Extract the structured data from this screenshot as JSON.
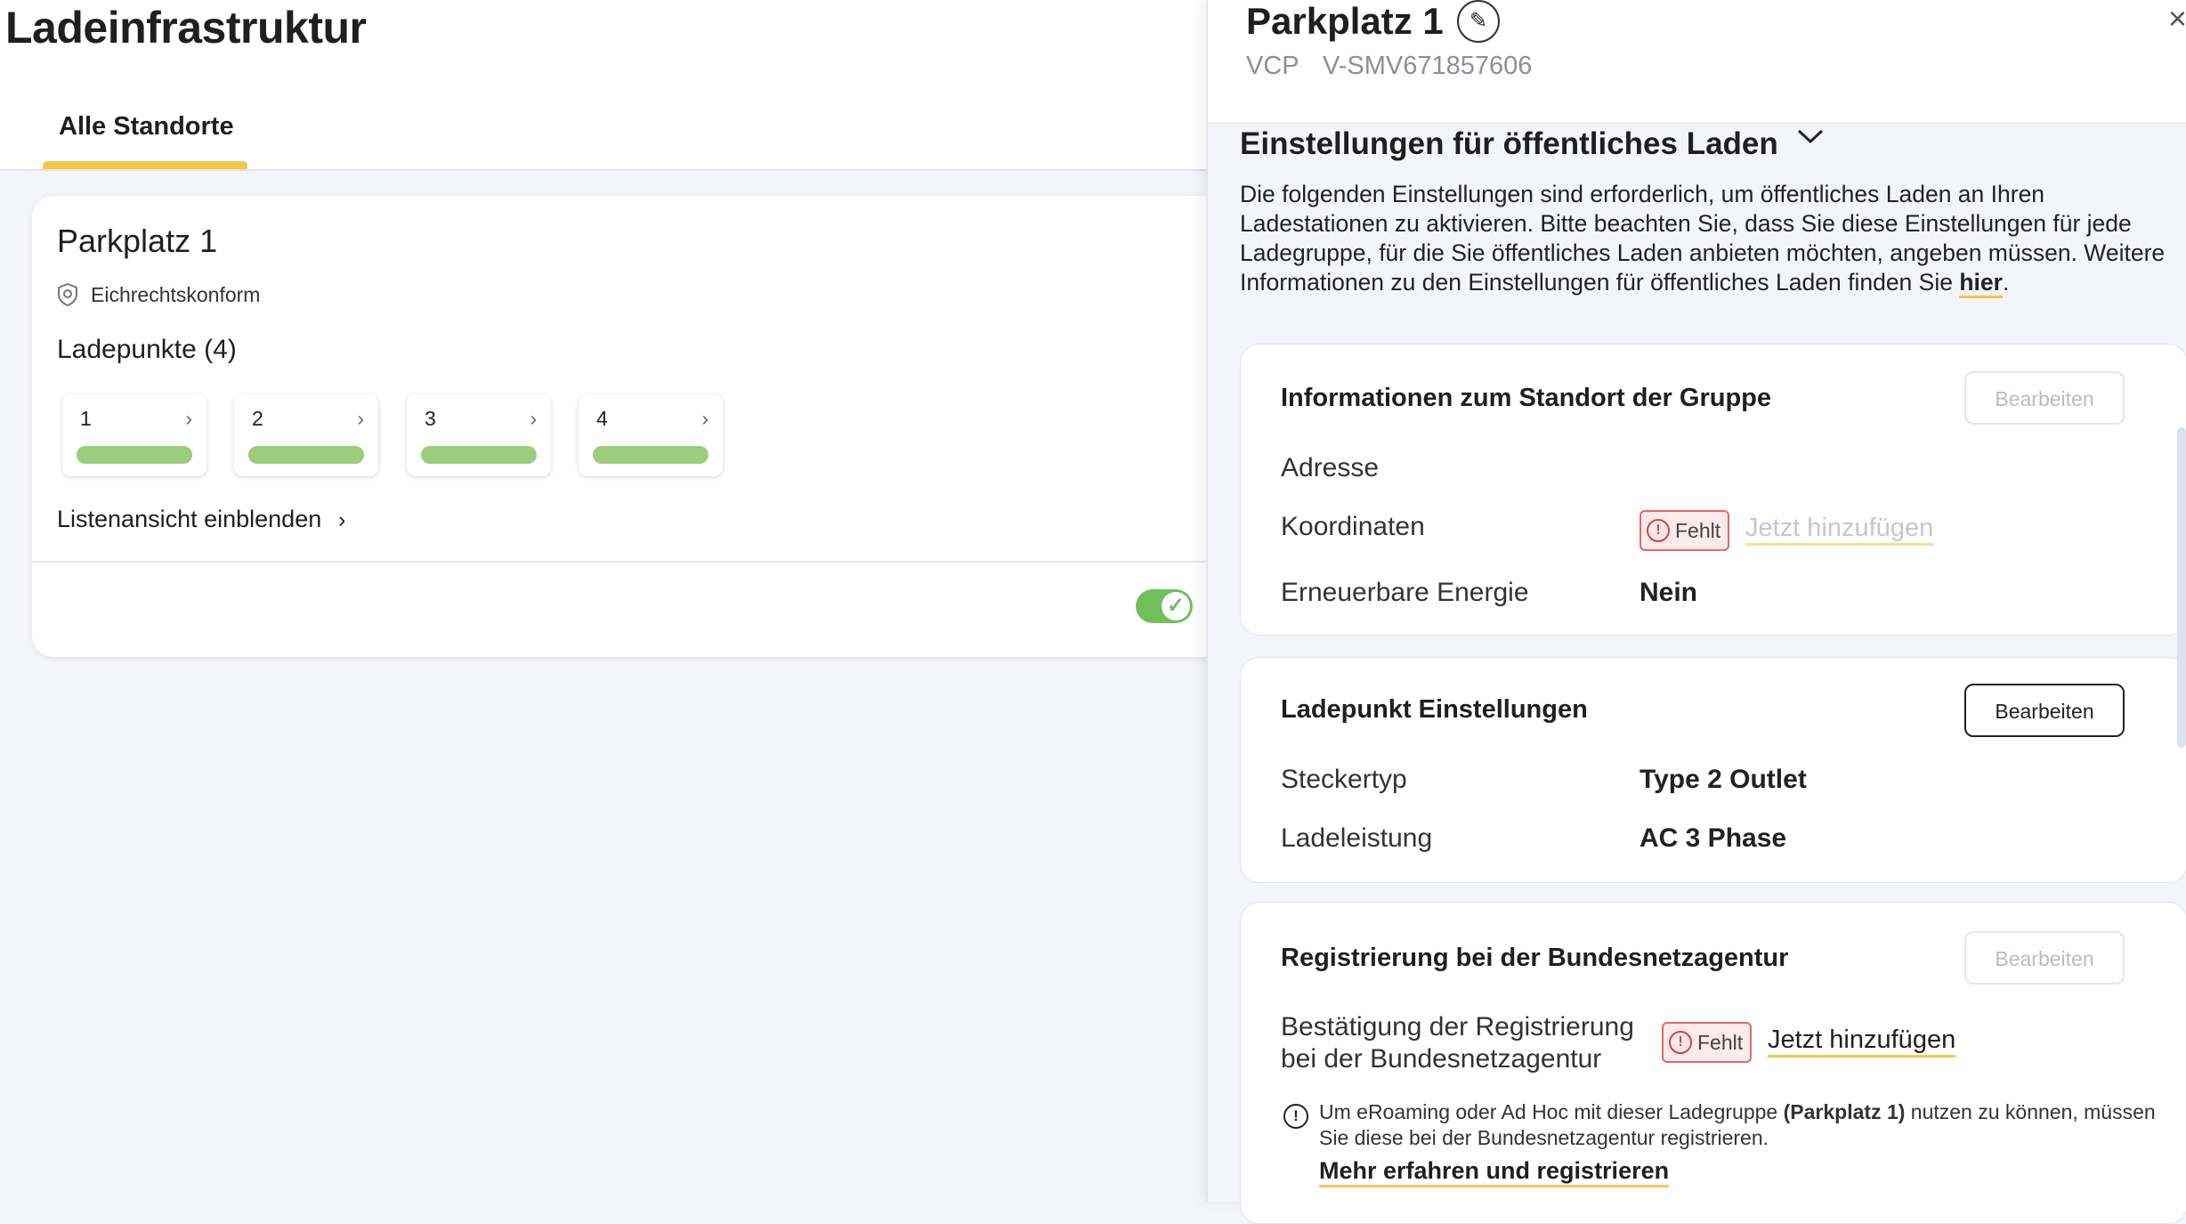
{
  "left": {
    "title": "Ladeinfrastruktur",
    "tab_label": "Alle Standorte",
    "site": {
      "name": "Parkplatz 1",
      "compliance_label": "Eichrechtskonform",
      "chargepoints_heading": "Ladepunkte (4)",
      "chargepoints": [
        "1",
        "2",
        "3",
        "4"
      ],
      "list_link": "Listenansicht einblenden",
      "toggle_on": true
    }
  },
  "panel": {
    "title": "Parkplatz 1",
    "vcp": "VCP",
    "id": "V-SMV671857606",
    "section_title": "Einstellungen für öffentliches Laden",
    "section_desc": "Die folgenden Einstellungen sind erforderlich, um öffentliches Laden an Ihren Ladestationen zu aktivieren. Bitte beachten Sie, dass Sie diese Einstellungen für jede Ladegruppe, für die Sie öffentliches Laden anbieten möchten, angeben müssen. Weitere Informationen zu den Einstellungen für öffentliches Laden finden Sie ",
    "section_link": "hier",
    "section_desc_end": ".",
    "location_card": {
      "title": "Informationen zum Standort der Gruppe",
      "edit": "Bearbeiten",
      "address_label": "Adresse",
      "coords_label": "Koordinaten",
      "missing": "Fehlt",
      "add": "Jetzt hinzufügen",
      "renewable_label": "Erneuerbare Energie",
      "renewable_value": "Nein"
    },
    "chargepoint_card": {
      "title": "Ladepunkt Einstellungen",
      "edit": "Bearbeiten",
      "plug_label": "Steckertyp",
      "plug_value": "Type 2 Outlet",
      "power_label": "Ladeleistung",
      "power_value": "AC 3 Phase"
    },
    "registration_card": {
      "title": "Registrierung bei der Bundesnetzagentur",
      "edit": "Bearbeiten",
      "confirm_label_1": "Bestätigung der Registrierung",
      "confirm_label_2": "bei der Bundesnetzagentur",
      "missing": "Fehlt",
      "add": "Jetzt hinzufügen",
      "info_pre": "Um eRoaming oder Ad Hoc mit dieser Ladegruppe ",
      "info_bold": "(Parkplatz 1)",
      "info_post": " nutzen zu können, müssen Sie diese bei der Bundesnetzagentur registrieren.",
      "more_link": "Mehr erfahren und registrieren"
    }
  },
  "colors": {
    "accent": "#f6c64b",
    "success": "#6fbf5a",
    "chargepoint_bar": "#9ccd7a",
    "error": "#d9413f"
  }
}
